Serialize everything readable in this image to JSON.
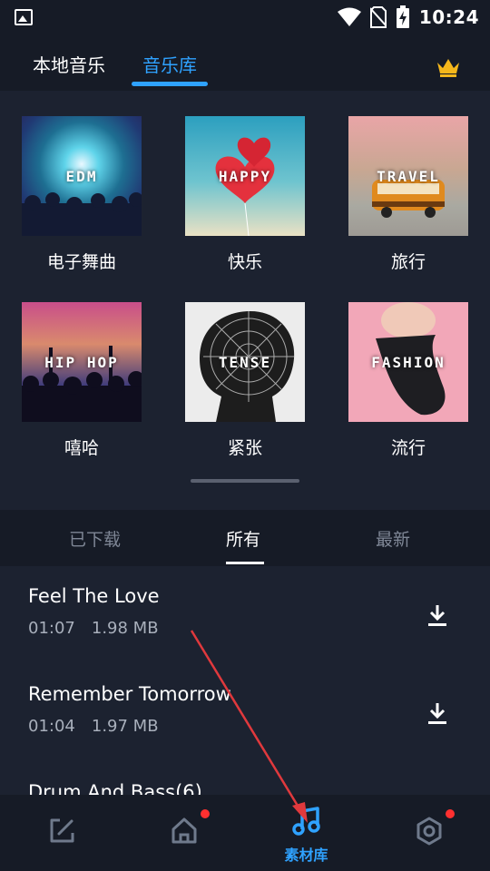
{
  "status_bar": {
    "time": "10:24",
    "icons": [
      "image-icon",
      "wifi-icon",
      "no-sim-icon",
      "battery-charging-icon"
    ]
  },
  "top_tabs": {
    "local": "本地音乐",
    "library": "音乐库",
    "premium_icon": "crown-icon"
  },
  "categories": [
    {
      "thumb_label": "EDM",
      "name": "电子舞曲"
    },
    {
      "thumb_label": "HAPPY",
      "name": "快乐"
    },
    {
      "thumb_label": "TRAVEL",
      "name": "旅行"
    },
    {
      "thumb_label": "HIP HOP",
      "name": "嘻哈"
    },
    {
      "thumb_label": "TENSE",
      "name": "紧张"
    },
    {
      "thumb_label": "FASHION",
      "name": "流行"
    }
  ],
  "sub_tabs": {
    "downloaded": "已下载",
    "all": "所有",
    "newest": "最新"
  },
  "tracks": [
    {
      "title": "Feel The Love",
      "duration": "01:07",
      "size": "1.98 MB"
    },
    {
      "title": "Remember Tomorrow",
      "duration": "01:04",
      "size": "1.97 MB"
    },
    {
      "title": "Drum And Bass(6)",
      "duration": "",
      "size": ""
    }
  ],
  "bottom_nav": {
    "material_label": "素材库",
    "accent": "#2fa2ff",
    "badge_color": "#ff3030"
  }
}
